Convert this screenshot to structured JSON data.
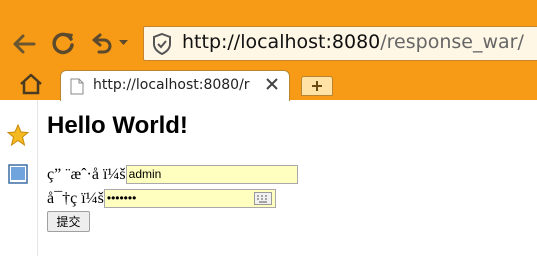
{
  "toolbar": {
    "url_scheme_host": "http://localhost:8080",
    "url_path": "/response_war/"
  },
  "tab": {
    "title": "http://localhost:8080/r"
  },
  "icons": {
    "back": "back-arrow-icon",
    "reload": "reload-icon",
    "undo": "undo-icon",
    "security": "shield-icon",
    "home": "home-icon",
    "page": "page-icon",
    "close": "close-icon",
    "new_tab": "plus-icon",
    "favorites": "star-icon",
    "sidebar_panel": "sidebar-panel-icon",
    "keyboard": "keyboard-icon"
  },
  "colors": {
    "chrome": "#f79b16",
    "field_bg": "#ffffc0"
  },
  "page": {
    "heading": "Hello World!",
    "username_label": "ç” ¨æˆ·å  ï¼š",
    "username_value": "admin",
    "password_label": "å¯†ç  ï¼š",
    "password_value": "•••••••",
    "submit_label": "提交"
  }
}
